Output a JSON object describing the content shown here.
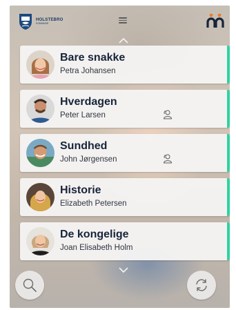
{
  "header": {
    "logo_line1": "HOLSTEBRO",
    "logo_line2": "KOMMUNE"
  },
  "icons": {
    "menu": "hamburger-icon",
    "brand": "brand-logo-icon",
    "up": "chevron-up-icon",
    "down": "chevron-down-icon",
    "group": "group-icon",
    "search": "search-icon",
    "refresh": "refresh-icon"
  },
  "cards": [
    {
      "title": "Bare snakke",
      "name": "Petra Johansen",
      "group": false
    },
    {
      "title": "Hverdagen",
      "name": "Peter Larsen",
      "group": true
    },
    {
      "title": "Sundhed",
      "name": "John Jørgensen",
      "group": true
    },
    {
      "title": "Historie",
      "name": "Elizabeth Petersen",
      "group": false
    },
    {
      "title": "De kongelige",
      "name": "Joan Elisabeth Holm",
      "group": false
    }
  ],
  "colors": {
    "accent": "#2fd2a0",
    "brand_orange": "#f07d28",
    "brand_dark": "#18243a",
    "text_dark": "#18243a"
  }
}
